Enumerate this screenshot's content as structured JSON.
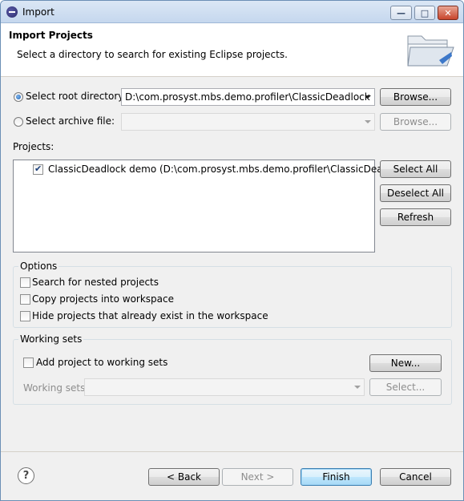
{
  "window": {
    "title": "Import",
    "controls": {
      "minimize": "—",
      "maximize": "□",
      "close": "✕"
    }
  },
  "header": {
    "title": "Import Projects",
    "description": "Select a directory to search for existing Eclipse projects.",
    "icon": "folder-icon"
  },
  "source": {
    "root_directory": {
      "label": "Select root directory:",
      "selected": true,
      "value": "D:\\com.prosyst.mbs.demo.profiler\\ClassicDeadlock",
      "browse_label": "Browse..."
    },
    "archive_file": {
      "label": "Select archive file:",
      "selected": false,
      "value": "",
      "browse_label": "Browse..."
    }
  },
  "projects": {
    "label": "Projects:",
    "items": [
      {
        "label": "ClassicDeadlock demo (D:\\com.prosyst.mbs.demo.profiler\\ClassicDeadlock)",
        "checked": true
      }
    ],
    "select_all_label": "Select All",
    "deselect_all_label": "Deselect All",
    "refresh_label": "Refresh"
  },
  "options": {
    "title": "Options",
    "items": [
      {
        "label": "Search for nested projects",
        "checked": false
      },
      {
        "label": "Copy projects into workspace",
        "checked": false
      },
      {
        "label": "Hide projects that already exist in the workspace",
        "checked": false
      }
    ]
  },
  "working_sets": {
    "title": "Working sets",
    "add_label": "Add project to working sets",
    "add_checked": false,
    "new_label": "New...",
    "sets_label": "Working sets:",
    "sets_value": "",
    "select_label": "Select..."
  },
  "footer": {
    "help_icon": "?",
    "back_label": "< Back",
    "next_label": "Next >",
    "finish_label": "Finish",
    "cancel_label": "Cancel"
  },
  "colors": {
    "window_bg": "#f0f0f0",
    "header_bg": "#ffffff",
    "titlebar": "#c5d7ee",
    "default_button": "#3c7fb1"
  }
}
